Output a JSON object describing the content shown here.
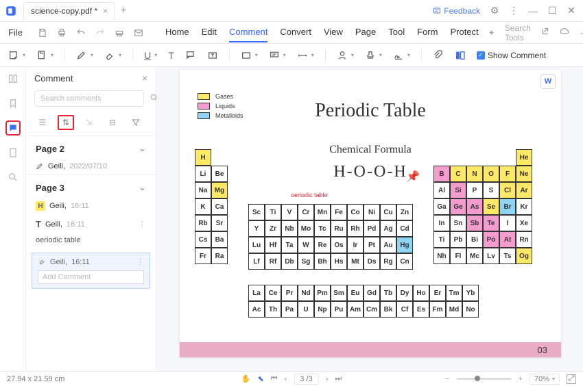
{
  "tab": {
    "name": "science-copy.pdf *"
  },
  "feedback": "Feedback",
  "menubar": {
    "file": "File",
    "tabs": [
      "Home",
      "Edit",
      "Comment",
      "Convert",
      "View",
      "Page",
      "Tool",
      "Form",
      "Protect"
    ],
    "active": "Comment",
    "search": "Search Tools"
  },
  "toolbar": {
    "showcomment": "Show Comment"
  },
  "side": {
    "title": "Comment",
    "searchPlaceholder": "Search comments",
    "page2": "Page 2",
    "page3": "Page 3",
    "u": "Geili,",
    "date": "2022/07/10",
    "time": "16:11",
    "body": "oeriodic table",
    "addPlaceholder": "Add Comment"
  },
  "doc": {
    "legend": {
      "g": "Gases",
      "l": "Liquids",
      "m": "Metalloids"
    },
    "title": "Periodic Table",
    "subtitle": "Chemical Formula",
    "formula": "H-O-O-H",
    "redtext": "oeriodic table",
    "pagenum": "03"
  },
  "status": {
    "dim": "27.94 x 21.59 cm",
    "page": "3 /3",
    "zoom": "70%"
  },
  "pt": {
    "left": [
      [
        "H:y",
        ""
      ],
      [
        "Li",
        "Be"
      ],
      [
        "Na",
        "Mg:y"
      ],
      [
        "K",
        "Ca"
      ],
      [
        "Rb",
        "Sr"
      ],
      [
        "Cs",
        "Ba"
      ],
      [
        "Fr",
        "Ra"
      ]
    ],
    "mid": [
      [
        "Sc",
        "Ti",
        "V",
        "Cr",
        "Mn",
        "Fe",
        "Co",
        "Ni",
        "Cu",
        "Zn"
      ],
      [
        "Y",
        "Zr",
        "Nb",
        "Mo",
        "Tc",
        "Ru",
        "Rh",
        "Pd",
        "Ag",
        "Cd"
      ],
      [
        "Lu",
        "Hf",
        "Ta",
        "W",
        "Re",
        "Os",
        "Ir",
        "Pt",
        "Au",
        "Hg:b"
      ],
      [
        "Lf",
        "Rf",
        "Db",
        "Sg",
        "Bh",
        "Hs",
        "Mt",
        "Ds",
        "Rg",
        "Cn"
      ]
    ],
    "right": [
      [
        "",
        "",
        "",
        "",
        "",
        "He:y"
      ],
      [
        "B:p",
        "C:y",
        "N:y",
        "O:y",
        "F:y",
        "Ne:y"
      ],
      [
        "Al",
        "Si:p",
        "P",
        "S",
        "Cl:y",
        "Ar:y"
      ],
      [
        "Ga",
        "Ge:p",
        "As:p",
        "Se:y",
        "Br:b",
        "Kr"
      ],
      [
        "In",
        "Sn",
        "Sb:p",
        "Te:p",
        "I",
        "Xe"
      ],
      [
        "Ti",
        "Pb",
        "Bi",
        "Po:p",
        "At:p",
        "Rn"
      ],
      [
        "Nh",
        "Fl",
        "Mc",
        "Lv",
        "Ts",
        "Og:y"
      ]
    ],
    "bottom": [
      [
        "La",
        "Ce",
        "Pr",
        "Nd",
        "Pm",
        "Sm",
        "Eu",
        "Gd",
        "Tb",
        "Dy",
        "Ho",
        "Er",
        "Tm",
        "Yb"
      ],
      [
        "Ac",
        "Th",
        "Pa",
        "U",
        "Np",
        "Pu",
        "Am",
        "Cm",
        "Bk",
        "Cf",
        "Es",
        "Fm",
        "Md",
        "No"
      ]
    ]
  }
}
